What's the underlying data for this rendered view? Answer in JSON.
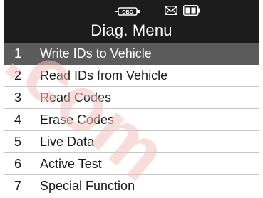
{
  "status_bar": {
    "obd_icon": "obd-connector-icon",
    "mail_icon": "mail-icon",
    "battery_icon": "battery-icon"
  },
  "header": {
    "title": "Diag. Menu"
  },
  "menu": {
    "items": [
      {
        "num": "1",
        "label": "Write IDs to Vehicle",
        "selected": true
      },
      {
        "num": "2",
        "label": "Read IDs from Vehicle",
        "selected": false
      },
      {
        "num": "3",
        "label": "Read Codes",
        "selected": false
      },
      {
        "num": "4",
        "label": "Erase Codes",
        "selected": false
      },
      {
        "num": "5",
        "label": "Live Data",
        "selected": false
      },
      {
        "num": "6",
        "label": "Active Test",
        "selected": false
      },
      {
        "num": "7",
        "label": "Special Function",
        "selected": false
      }
    ]
  },
  "watermark": {
    "text": ".com"
  },
  "colors": {
    "header_bg": "#1c1c1c",
    "selected_bg": "#5b5b5b",
    "divider": "#c6c6c6",
    "watermark": "#f3c2c2"
  }
}
